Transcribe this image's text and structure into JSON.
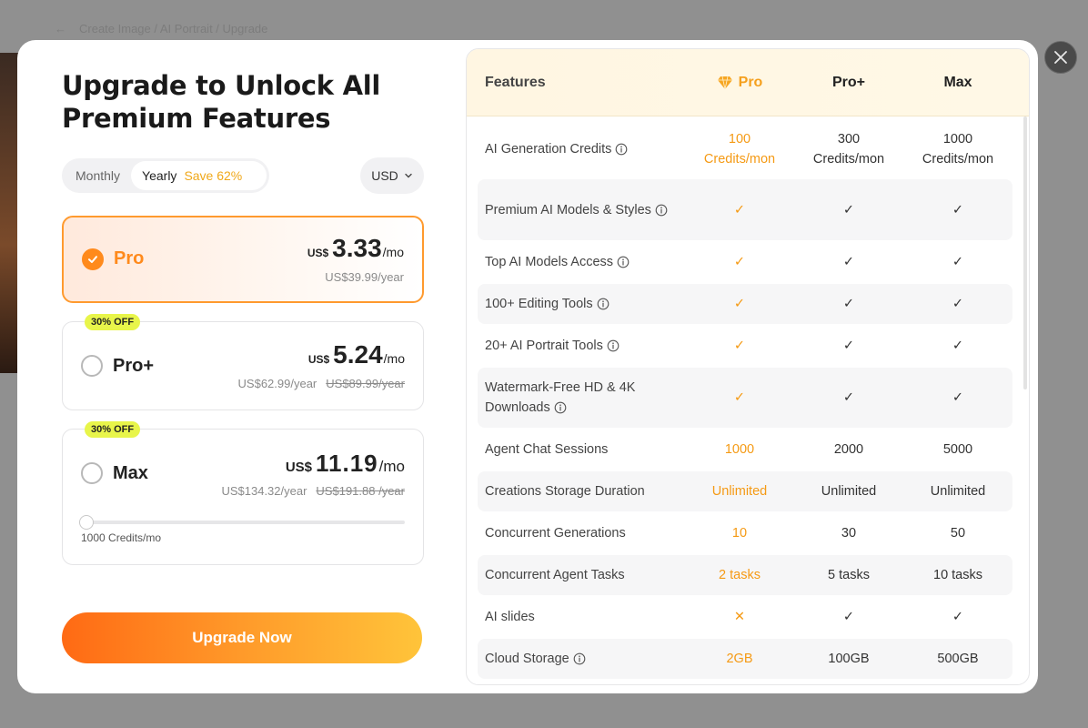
{
  "background": {
    "breadcrumb": "Create Image / AI Portrait / Upgrade"
  },
  "title": "Upgrade to Unlock All Premium Features",
  "billing": {
    "monthly_label": "Monthly",
    "yearly_label": "Yearly",
    "save_label": "Save 62%",
    "currency": "USD"
  },
  "plans": [
    {
      "name": "Pro",
      "currency_prefix": "US$",
      "price": "3.33",
      "per": "/mo",
      "yearly": "US$39.99/year",
      "original": "",
      "badge": "",
      "selected": true
    },
    {
      "name": "Pro+",
      "currency_prefix": "US$",
      "price": "5.24",
      "per": "/mo",
      "yearly": "US$62.99/year",
      "original": "US$89.99/year",
      "badge": "30% OFF",
      "selected": false
    },
    {
      "name": "Max",
      "currency_prefix": "US$",
      "price": "11.19",
      "per": "/mo",
      "yearly": "US$134.32/year",
      "original": "US$191.88 /year",
      "badge": "30% OFF",
      "selected": false,
      "slider_label": "1000 Credits/mo",
      "slider_value": 0
    }
  ],
  "upgrade_button": "Upgrade Now",
  "features": {
    "header": {
      "feature": "Features",
      "pro": "Pro",
      "proplus": "Pro+",
      "max": "Max"
    },
    "rows": [
      {
        "name": "AI Generation Credits",
        "info": true,
        "pro": "100\nCredits/mon",
        "proplus": "300\nCredits/mon",
        "max": "1000\nCredits/mon"
      },
      {
        "name": "Premium AI Models & Styles",
        "info": true,
        "pro": "✓",
        "proplus": "✓",
        "max": "✓"
      },
      {
        "name": "Top AI Models Access",
        "info": true,
        "pro": "✓",
        "proplus": "✓",
        "max": "✓"
      },
      {
        "name": "100+ Editing Tools",
        "info": true,
        "pro": "✓",
        "proplus": "✓",
        "max": "✓"
      },
      {
        "name": "20+ AI Portrait Tools",
        "info": true,
        "pro": "✓",
        "proplus": "✓",
        "max": "✓"
      },
      {
        "name": "Watermark-Free HD & 4K Downloads",
        "info": true,
        "pro": "✓",
        "proplus": "✓",
        "max": "✓"
      },
      {
        "name": "Agent Chat Sessions",
        "info": false,
        "pro": "1000",
        "proplus": "2000",
        "max": "5000"
      },
      {
        "name": "Creations Storage Duration",
        "info": false,
        "pro": "Unlimited",
        "proplus": "Unlimited",
        "max": "Unlimited"
      },
      {
        "name": "Concurrent Generations",
        "info": false,
        "pro": "10",
        "proplus": "30",
        "max": "50"
      },
      {
        "name": "Concurrent Agent Tasks",
        "info": false,
        "pro": "2 tasks",
        "proplus": "5 tasks",
        "max": "10 tasks"
      },
      {
        "name": "AI slides",
        "info": false,
        "pro": "✕",
        "proplus": "✓",
        "max": "✓"
      },
      {
        "name": "Cloud Storage",
        "info": true,
        "pro": "2GB",
        "proplus": "100GB",
        "max": "500GB"
      }
    ]
  },
  "colors": {
    "accent": "#ff8a1c",
    "badge": "#e8f54a",
    "pro_text": "#f59a14"
  }
}
